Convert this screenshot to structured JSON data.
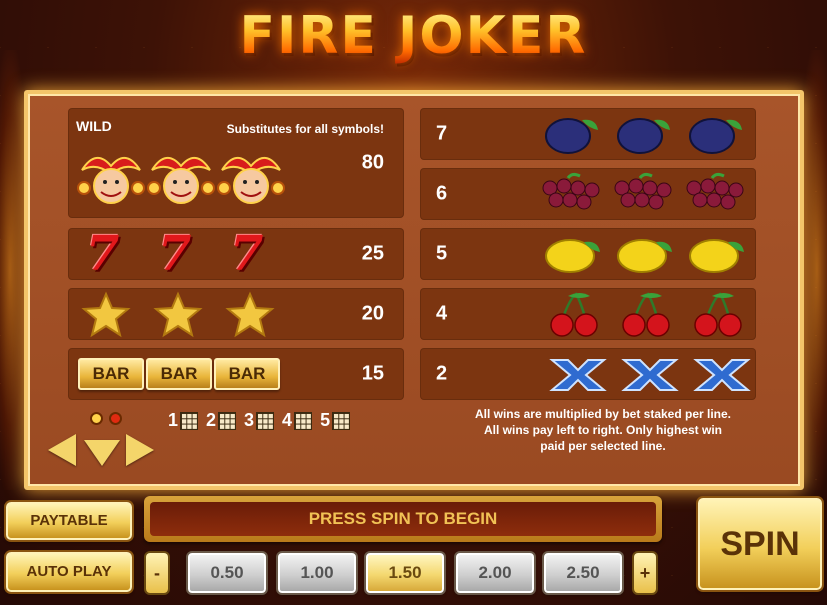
{
  "title": "FIRE JOKER",
  "wild": {
    "label": "WILD",
    "description": "Substitutes for all symbols!",
    "payout": "80",
    "icon": "joker-icon"
  },
  "left_rows": [
    {
      "symbol": "seven-icon",
      "glyph": "7",
      "payout": "25"
    },
    {
      "symbol": "star-icon",
      "payout": "20"
    },
    {
      "symbol": "bar-icon",
      "glyph": "BAR",
      "payout": "15"
    }
  ],
  "right_rows": [
    {
      "count": "7",
      "symbol": "plum-icon"
    },
    {
      "count": "6",
      "symbol": "grapes-icon"
    },
    {
      "count": "5",
      "symbol": "lemon-icon"
    },
    {
      "count": "4",
      "symbol": "cherry-icon"
    },
    {
      "count": "2",
      "symbol": "x-icon"
    }
  ],
  "paylines": [
    "1",
    "2",
    "3",
    "4",
    "5"
  ],
  "info": {
    "line1": "All wins are multiplied by bet staked per line.",
    "line2": "All wins pay left to right. Only highest win",
    "line3": "paid per selected line."
  },
  "buttons": {
    "paytable": "PAYTABLE",
    "autoplay": "AUTO PLAY",
    "spin": "SPIN",
    "minus": "-",
    "plus": "+"
  },
  "message": "PRESS SPIN TO BEGIN",
  "stakes": {
    "options": [
      "0.50",
      "1.00",
      "1.50",
      "2.00",
      "2.50"
    ],
    "selected": "1.50"
  },
  "colors": {
    "seven": "#e1181b",
    "star": "#f2c740",
    "plum": "#2b2f7a",
    "grapes": "#8a1a3a",
    "lemon": "#f3d31a",
    "cherry": "#d4141c",
    "x": "#2f6bd0"
  }
}
